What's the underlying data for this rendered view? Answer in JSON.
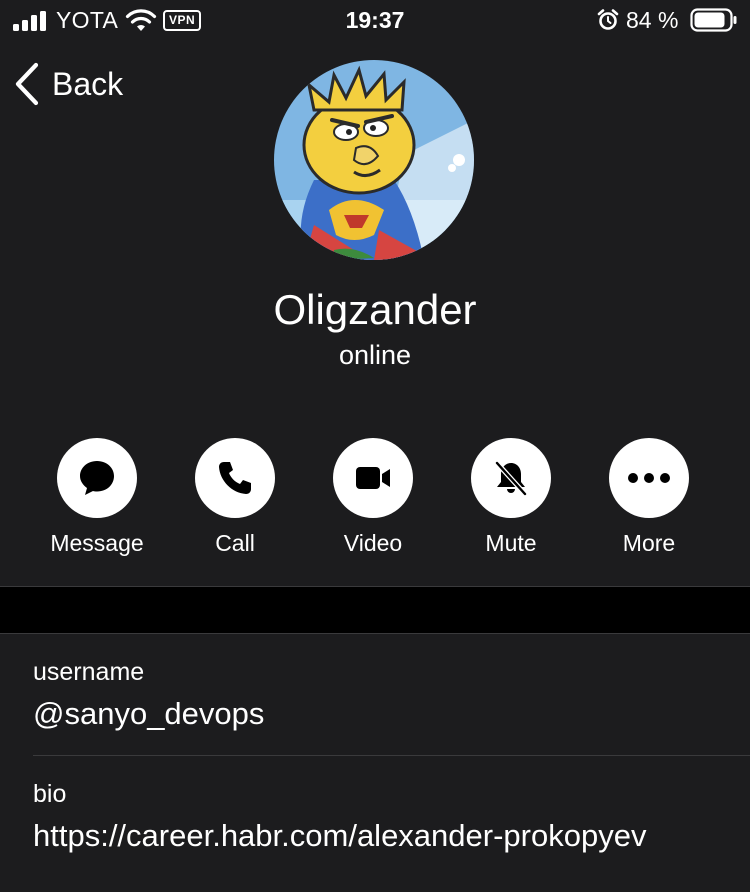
{
  "status_bar": {
    "carrier": "YOTA",
    "vpn_label": "VPN",
    "time": "19:37",
    "battery_percent": "84 %",
    "icons": [
      "signal-icon",
      "wifi-icon",
      "vpn-icon",
      "alarm-icon",
      "battery-icon"
    ]
  },
  "nav": {
    "back_label": "Back"
  },
  "profile": {
    "name": "Oligzander",
    "status": "online"
  },
  "actions": [
    {
      "label": "Message",
      "icon": "message-bubble-icon"
    },
    {
      "label": "Call",
      "icon": "phone-icon"
    },
    {
      "label": "Video",
      "icon": "video-camera-icon"
    },
    {
      "label": "Mute",
      "icon": "bell-slash-icon"
    },
    {
      "label": "More",
      "icon": "more-dots-icon"
    }
  ],
  "info": {
    "username_caption": "username",
    "username_value": "@sanyo_devops",
    "bio_caption": "bio",
    "bio_value": "https://career.habr.com/alexander-prokopyev"
  },
  "colors": {
    "background": "#1c1c1e",
    "separator": "#000000",
    "divider": "#3a3a3c",
    "text": "#ffffff"
  }
}
